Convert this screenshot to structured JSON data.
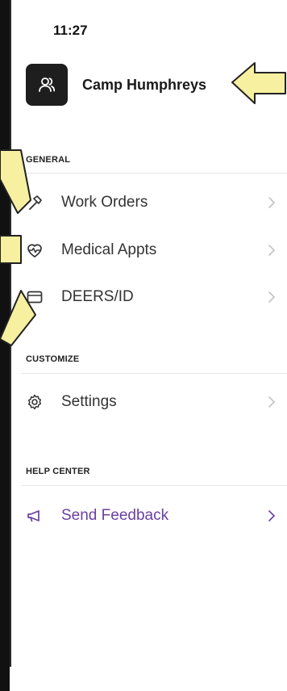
{
  "status": {
    "time": "11:27"
  },
  "profile": {
    "name": "Camp Humphreys",
    "icon": "users-icon"
  },
  "sections": {
    "general": {
      "title": "GENERAL",
      "items": [
        {
          "label": "Work Orders",
          "icon": "hammer-icon"
        },
        {
          "label": "Medical Appts",
          "icon": "heart-pulse-icon"
        },
        {
          "label": "DEERS/ID",
          "icon": "id-card-icon"
        }
      ]
    },
    "customize": {
      "title": "CUSTOMIZE",
      "items": [
        {
          "label": "Settings",
          "icon": "gear-icon"
        }
      ]
    },
    "help": {
      "title": "HELP CENTER",
      "items": [
        {
          "label": "Send Feedback",
          "icon": "megaphone-icon"
        }
      ]
    }
  },
  "colors": {
    "accent_purple": "#6b3fa0",
    "callout_yellow": "#f6f0a0",
    "avatar_bg": "#1e1e1e"
  }
}
